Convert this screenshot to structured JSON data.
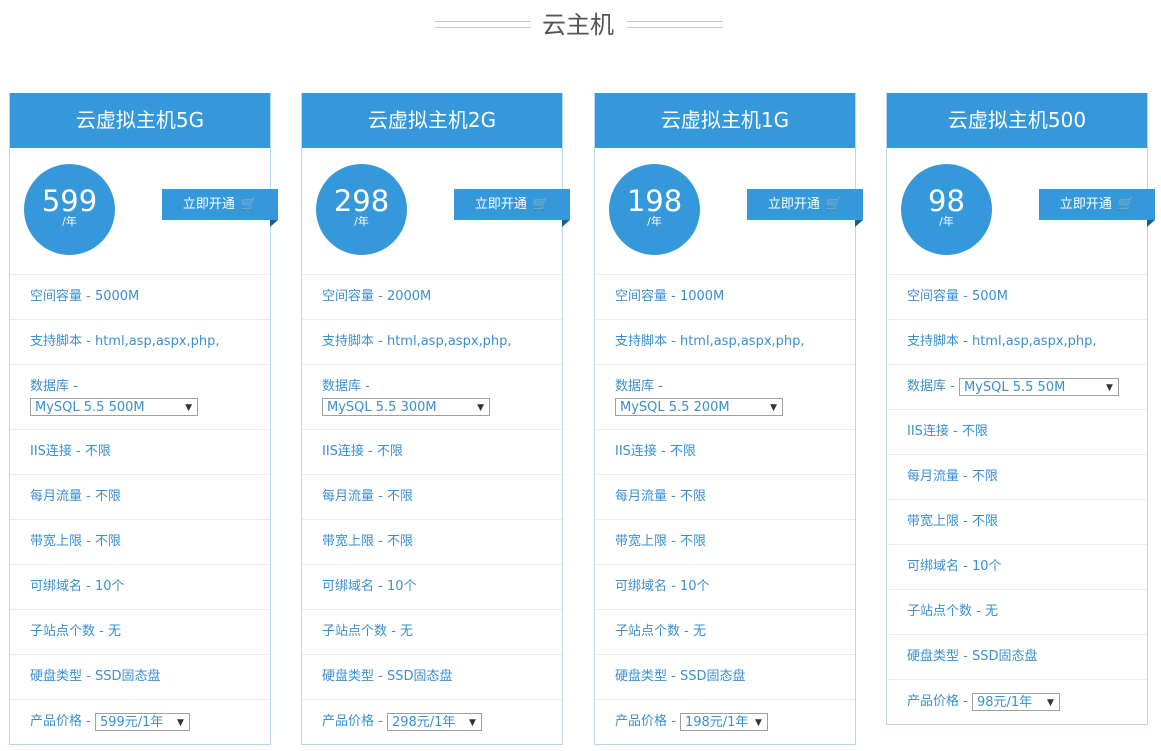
{
  "section": {
    "title": "云主机"
  },
  "icons": {
    "cart": "shopping-cart-icon",
    "dropdown": "triangle-down-icon"
  },
  "colors": {
    "accent": "#3498db",
    "text": "#3a8fd0",
    "border": "#b8d8f0"
  },
  "cards": [
    {
      "name": "云虚拟主机5G",
      "price": "599",
      "unit": "/年",
      "buy_label": "立即开通",
      "rows": {
        "space": "空间容量 - 5000M",
        "script": "支持脚本 - html,asp,aspx,php,",
        "db_label": "数据库 -",
        "db_value": "MySQL 5.5 500M",
        "iis": "IIS连接 - 不限",
        "traffic": "每月流量 - 不限",
        "bandwidth": "带宽上限 - 不限",
        "domains": "可绑域名 - 10个",
        "subsites": "子站点个数 - 无",
        "disk": "硬盘类型 - SSD固态盘",
        "price_label": "产品价格 -",
        "price_value": "599元/1年"
      }
    },
    {
      "name": "云虚拟主机2G",
      "price": "298",
      "unit": "/年",
      "buy_label": "立即开通",
      "rows": {
        "space": "空间容量 - 2000M",
        "script": "支持脚本 - html,asp,aspx,php,",
        "db_label": "数据库 -",
        "db_value": "MySQL 5.5 300M",
        "iis": "IIS连接 - 不限",
        "traffic": "每月流量 - 不限",
        "bandwidth": "带宽上限 - 不限",
        "domains": "可绑域名 - 10个",
        "subsites": "子站点个数 - 无",
        "disk": "硬盘类型 - SSD固态盘",
        "price_label": "产品价格 -",
        "price_value": "298元/1年"
      }
    },
    {
      "name": "云虚拟主机1G",
      "price": "198",
      "unit": "/年",
      "buy_label": "立即开通",
      "rows": {
        "space": "空间容量 - 1000M",
        "script": "支持脚本 - html,asp,aspx,php,",
        "db_label": "数据库 -",
        "db_value": "MySQL 5.5 200M",
        "iis": "IIS连接 - 不限",
        "traffic": "每月流量 - 不限",
        "bandwidth": "带宽上限 - 不限",
        "domains": "可绑域名 - 10个",
        "subsites": "子站点个数 - 无",
        "disk": "硬盘类型 - SSD固态盘",
        "price_label": "产品价格 -",
        "price_value": "198元/1年"
      }
    },
    {
      "name": "云虚拟主机500",
      "price": "98",
      "unit": "/年",
      "buy_label": "立即开通",
      "rows": {
        "space": "空间容量 - 500M",
        "script": "支持脚本 - html,asp,aspx,php,",
        "db_label": "数据库 -",
        "db_value": "MySQL 5.5 50M",
        "iis": "IIS连接 - 不限",
        "traffic": "每月流量 - 不限",
        "bandwidth": "带宽上限 - 不限",
        "domains": "可绑域名 - 10个",
        "subsites": "子站点个数 - 无",
        "disk": "硬盘类型 - SSD固态盘",
        "price_label": "产品价格 -",
        "price_value": "98元/1年"
      }
    }
  ]
}
